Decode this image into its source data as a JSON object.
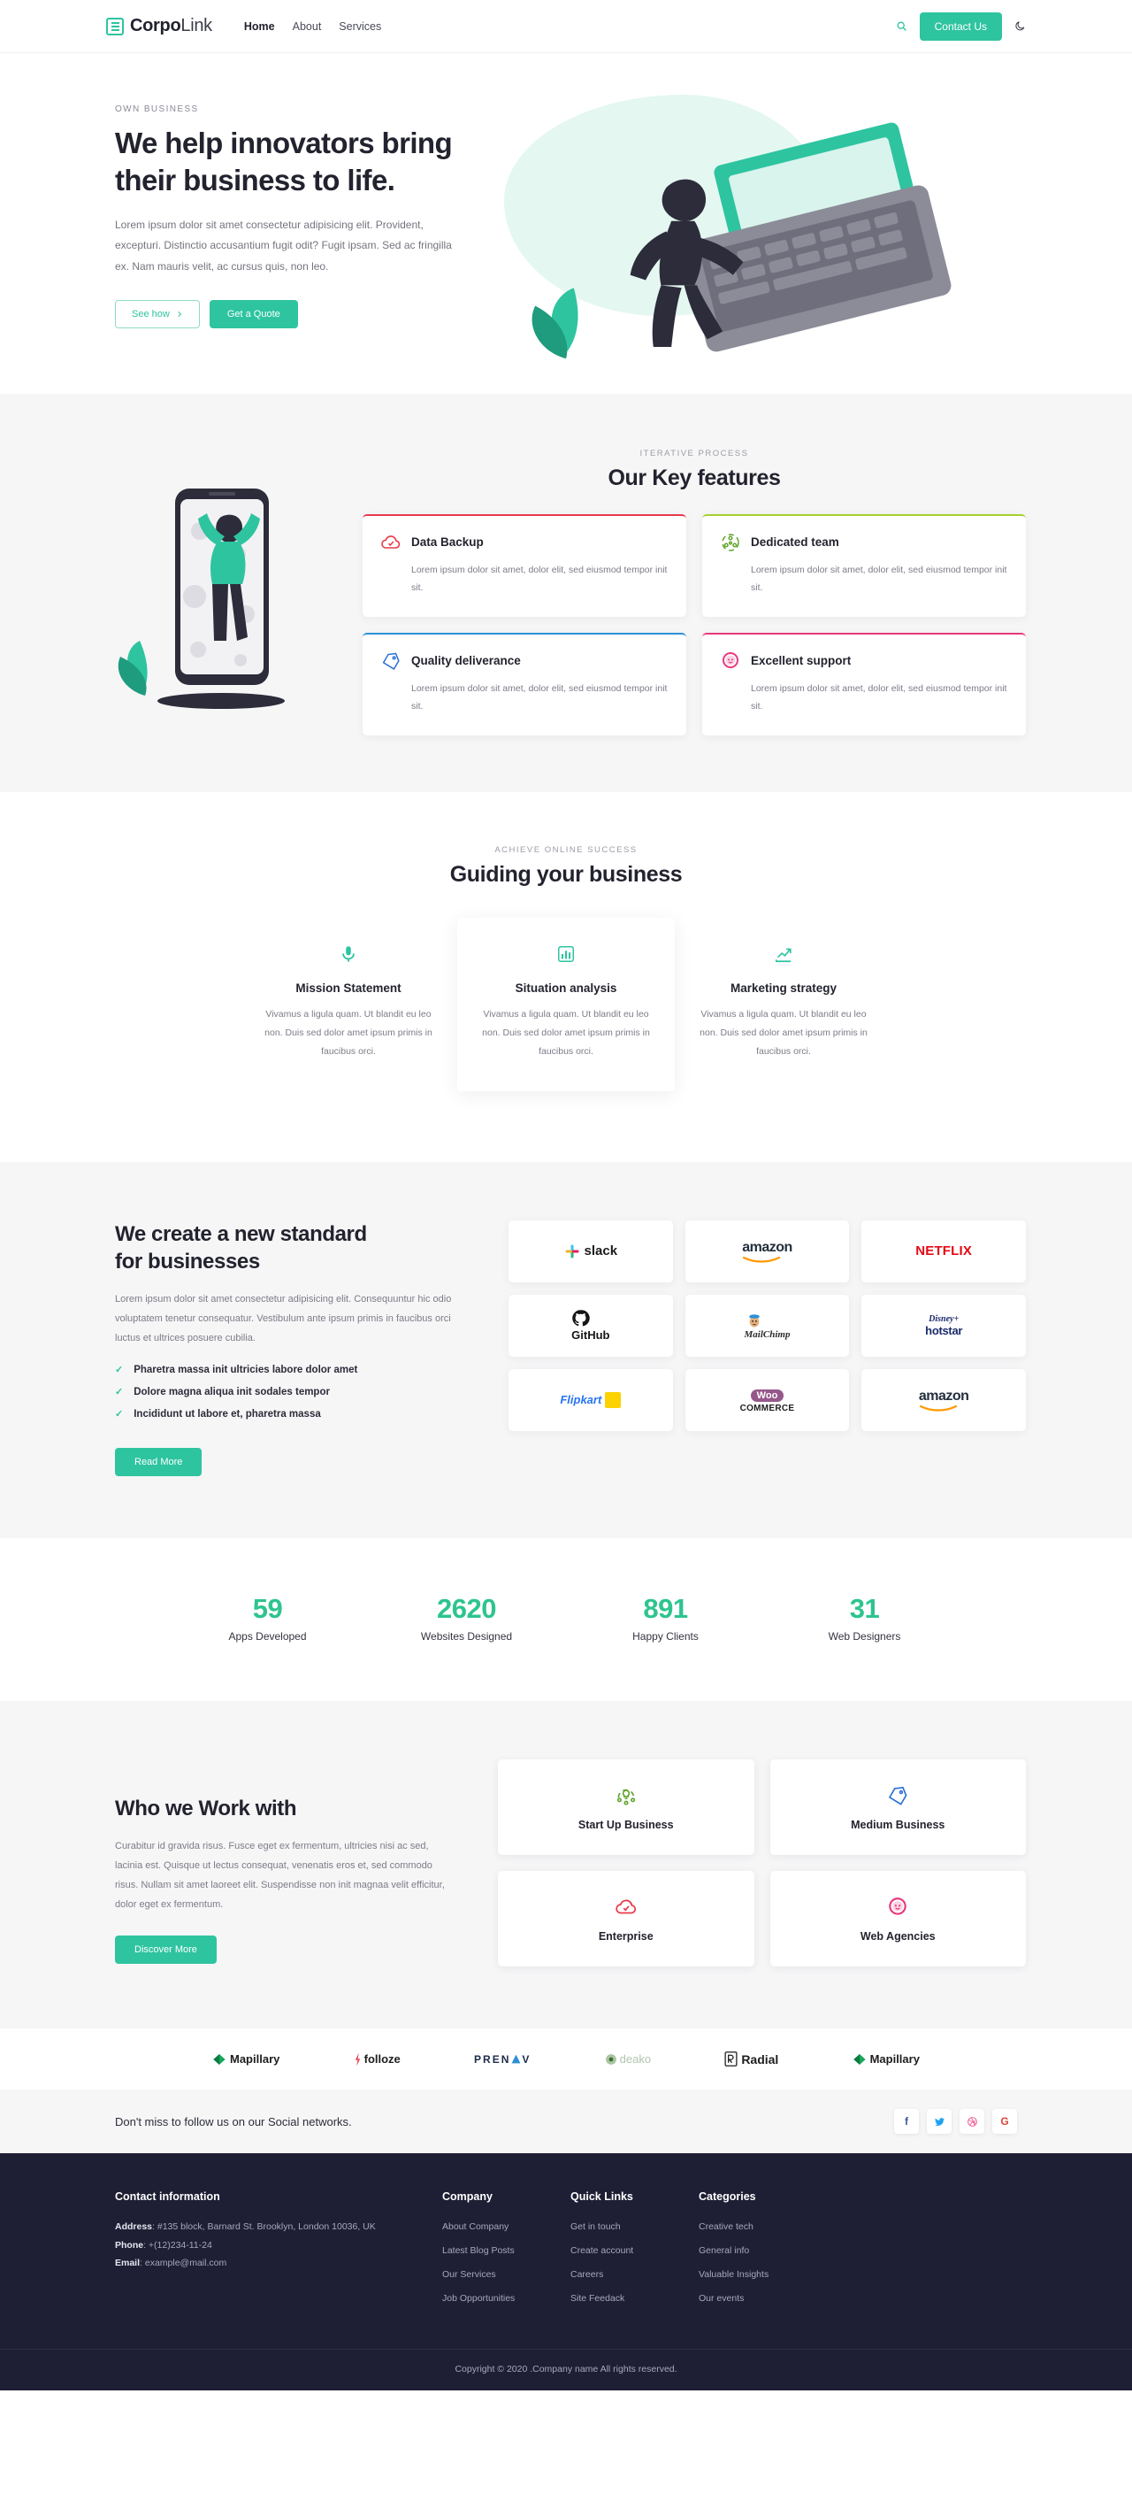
{
  "header": {
    "brand_bold": "Corpo",
    "brand_light": "Link",
    "brand_icon": "newspaper-icon",
    "nav": [
      {
        "label": "Home",
        "active": true
      },
      {
        "label": "About",
        "active": false
      },
      {
        "label": "Services",
        "active": false
      }
    ],
    "search_icon": "search-icon",
    "contact_label": "Contact Us",
    "theme_icon": "moon-icon"
  },
  "hero": {
    "eyebrow": "OWN BUSINESS",
    "title_line1": "We help innovators bring",
    "title_line2": "their business to life.",
    "paragraph": "Lorem ipsum dolor sit amet consectetur adipisicing elit. Provident, excepturi. Distinctio accusantium fugit odit? Fugit ipsam. Sed ac fringilla ex. Nam mauris velit, ac cursus quis, non leo.",
    "btn_outline": "See how",
    "btn_outline_icon": "chevron-right-icon",
    "btn_solid": "Get a Quote"
  },
  "features": {
    "eyebrow": "ITERATIVE PROCESS",
    "title": "Our Key features",
    "cards": [
      {
        "title": "Data Backup",
        "desc": "Lorem ipsum dolor sit amet, dolor elit, sed eiusmod tempor init sit.",
        "accent": "#e8394a",
        "icon": "cloud-check-icon"
      },
      {
        "title": "Dedicated team",
        "desc": "Lorem ipsum dolor sit amet, dolor elit, sed eiusmod tempor init sit.",
        "accent": "#a8cf2c",
        "icon": "team-circle-icon"
      },
      {
        "title": "Quality deliverance",
        "desc": "Lorem ipsum dolor sit amet, dolor elit, sed eiusmod tempor init sit.",
        "accent": "#2b8fd6",
        "icon": "price-tag-icon"
      },
      {
        "title": "Excellent support",
        "desc": "Lorem ipsum dolor sit amet, dolor elit, sed eiusmod tempor init sit.",
        "accent": "#e8397e",
        "icon": "support-agent-icon"
      }
    ]
  },
  "guiding": {
    "eyebrow": "ACHIEVE ONLINE SUCCESS",
    "title": "Guiding your business",
    "cards": [
      {
        "title": "Mission Statement",
        "desc": "Vivamus a ligula quam. Ut blandit eu leo non. Duis sed dolor amet ipsum primis in faucibus orci.",
        "icon": "microphone-icon",
        "raised": false
      },
      {
        "title": "Situation analysis",
        "desc": "Vivamus a ligula quam. Ut blandit eu leo non. Duis sed dolor amet ipsum primis in faucibus orci.",
        "icon": "bar-chart-icon",
        "raised": true
      },
      {
        "title": "Marketing strategy",
        "desc": "Vivamus a ligula quam. Ut blandit eu leo non. Duis sed dolor amet ipsum primis in faucibus orci.",
        "icon": "trend-up-icon",
        "raised": false
      }
    ]
  },
  "standard": {
    "title_line1": "We create a new standard",
    "title_line2": "for businesses",
    "paragraph": "Lorem ipsum dolor sit amet consectetur adipisicing elit. Consequuntur hic odio voluptatem tenetur consequatur. Vestibulum ante ipsum primis in faucibus orci luctus et ultrices posuere cubilia.",
    "bullets": [
      "Pharetra massa init ultricies labore dolor amet",
      "Dolore magna aliqua init sodales tempor",
      "Incididunt ut labore et, pharetra massa"
    ],
    "button": "Read More",
    "logos": [
      {
        "name": "slack",
        "label": "slack"
      },
      {
        "name": "amazon",
        "label": "amazon"
      },
      {
        "name": "netflix",
        "label": "NETFLIX"
      },
      {
        "name": "github",
        "label": "GitHub"
      },
      {
        "name": "mailchimp",
        "label": "MailChimp"
      },
      {
        "name": "disney-hotstar",
        "label": "hotstar"
      },
      {
        "name": "flipkart",
        "label": "Flipkart"
      },
      {
        "name": "woocommerce",
        "label": "COMMERCE"
      },
      {
        "name": "amazon",
        "label": "amazon"
      }
    ]
  },
  "stats": [
    {
      "value": "59",
      "label": "Apps Developed"
    },
    {
      "value": "2620",
      "label": "Websites Designed"
    },
    {
      "value": "891",
      "label": "Happy Clients"
    },
    {
      "value": "31",
      "label": "Web Designers"
    }
  ],
  "workwith": {
    "title": "Who we Work with",
    "paragraph": "Curabitur id gravida risus. Fusce eget ex fermentum, ultricies nisi ac sed, lacinia est. Quisque ut lectus consequat, venenatis eros et, sed commodo risus. Nullam sit amet laoreet elit. Suspendisse non init magnaa velit efficitur, dolor eget ex fermentum.",
    "button": "Discover More",
    "cards": [
      {
        "label": "Start Up Business",
        "icon": "team-idea-icon"
      },
      {
        "label": "Medium Business",
        "icon": "price-tag-icon"
      },
      {
        "label": "Enterprise",
        "icon": "cloud-check-icon"
      },
      {
        "label": "Web Agencies",
        "icon": "support-agent-icon"
      }
    ]
  },
  "partners": [
    {
      "name": "mapillary",
      "label": "Mapillary"
    },
    {
      "name": "folloze",
      "label": "folloze"
    },
    {
      "name": "prenav",
      "label": "PREN"
    },
    {
      "name": "deako",
      "label": "deako"
    },
    {
      "name": "radial",
      "label": "Radial"
    },
    {
      "name": "mapillary",
      "label": "Mapillary"
    }
  ],
  "social": {
    "text": "Don't miss to follow us on our Social networks.",
    "icons": [
      {
        "name": "facebook-icon",
        "glyph": "f",
        "color": "#3b5998"
      },
      {
        "name": "twitter-icon",
        "glyph": "t",
        "color": "#1da1f2"
      },
      {
        "name": "dribbble-icon",
        "glyph": "d",
        "color": "#ea4c89"
      },
      {
        "name": "google-icon",
        "glyph": "G",
        "color": "#db4437"
      }
    ]
  },
  "footer": {
    "contact": {
      "heading": "Contact information",
      "address_label": "Address",
      "address_value": ": #135 block, Barnard St. Brooklyn, London 10036, UK",
      "phone_label": "Phone",
      "phone_value": ": +(12)234-11-24",
      "email_label": "Email",
      "email_value": ": example@mail.com"
    },
    "columns": [
      {
        "heading": "Company",
        "links": [
          "About Company",
          "Latest Blog Posts",
          "Our Services",
          "Job Opportunities"
        ]
      },
      {
        "heading": "Quick Links",
        "links": [
          "Get in touch",
          "Create account",
          "Careers",
          "Site Feedack"
        ]
      },
      {
        "heading": "Categories",
        "links": [
          "Creative tech",
          "General info",
          "Valuable Insights",
          "Our events"
        ]
      }
    ],
    "copyright": "Copyright © 2020 .Company name All rights reserved."
  },
  "colors": {
    "accent": "#2ec4a0",
    "dark": "#1e1e34",
    "gray_bg": "#f6f6f7"
  }
}
